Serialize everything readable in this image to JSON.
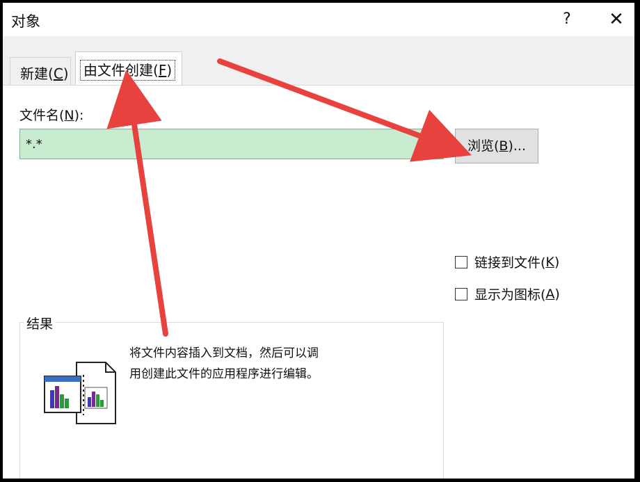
{
  "dialog": {
    "title": "对象",
    "help_glyph": "?",
    "close_glyph": "✕"
  },
  "tabs": [
    {
      "label_prefix": "新建(",
      "key": "C",
      "label_suffix": ")"
    },
    {
      "label_prefix": "由文件创建(",
      "key": "F",
      "label_suffix": ")"
    }
  ],
  "form": {
    "filename_label_prefix": "文件名(",
    "filename_key": "N",
    "filename_label_suffix": "):",
    "filename_value": "*.*",
    "browse_prefix": "浏览(",
    "browse_key": "B",
    "browse_suffix": ")..."
  },
  "options": [
    {
      "label_prefix": "链接到文件(",
      "key": "K",
      "label_suffix": ")",
      "checked": false
    },
    {
      "label_prefix": "显示为图标(",
      "key": "A",
      "label_suffix": ")",
      "checked": false
    }
  ],
  "result": {
    "legend": "结果",
    "description_line1": "将文件内容插入到文档，然后可以调",
    "description_line2": "用创建此文件的应用程序进行编辑。"
  },
  "annotation_color": "#e8423f"
}
